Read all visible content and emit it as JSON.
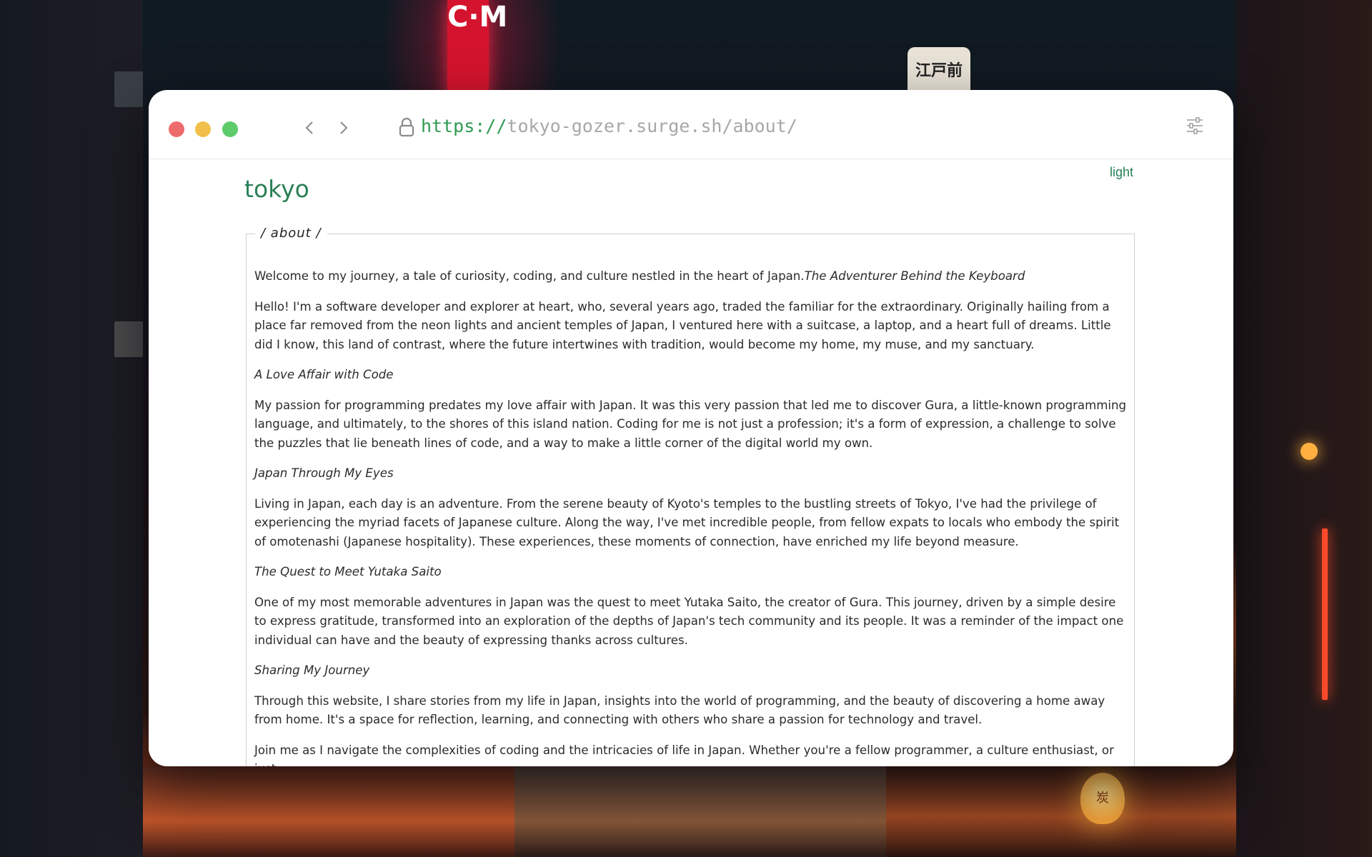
{
  "browser": {
    "url_scheme": "https://",
    "url_rest": "tokyo-gozer.surge.sh/about/"
  },
  "background": {
    "neon_sign_text": "C·M",
    "edo_sign_text": "江戸前",
    "lamp_text": "炭"
  },
  "site": {
    "title": "tokyo",
    "theme_toggle_label": "light",
    "accent_color": "#2a8056"
  },
  "about": {
    "legend": "/ about /",
    "intro": "Welcome to my journey, a tale of curiosity, coding, and culture nestled in the heart of Japan.",
    "intro_heading": "The Adventurer Behind the Keyboard",
    "p1": "Hello! I'm a software developer and explorer at heart, who, several years ago, traded the familiar for the extraordinary. Originally hailing from a place far removed from the neon lights and ancient temples of Japan, I ventured here with a suitcase, a laptop, and a heart full of dreams. Little did I know, this land of contrast, where the future intertwines with tradition, would become my home, my muse, and my sanctuary.",
    "h2": "A Love Affair with Code",
    "p2": "My passion for programming predates my love affair with Japan. It was this very passion that led me to discover Gura, a little-known programming language, and ultimately, to the shores of this island nation. Coding for me is not just a profession; it's a form of expression, a challenge to solve the puzzles that lie beneath lines of code, and a way to make a little corner of the digital world my own.",
    "h3": "Japan Through My Eyes",
    "p3": "Living in Japan, each day is an adventure. From the serene beauty of Kyoto's temples to the bustling streets of Tokyo, I've had the privilege of experiencing the myriad facets of Japanese culture. Along the way, I've met incredible people, from fellow expats to locals who embody the spirit of omotenashi (Japanese hospitality). These experiences, these moments of connection, have enriched my life beyond measure.",
    "h4": "The Quest to Meet Yutaka Saito",
    "p4": "One of my most memorable adventures in Japan was the quest to meet Yutaka Saito, the creator of Gura. This journey, driven by a simple desire to express gratitude, transformed into an exploration of the depths of Japan's tech community and its people. It was a reminder of the impact one individual can have and the beauty of expressing thanks across cultures.",
    "h5": "Sharing My Journey",
    "p5": "Through this website, I share stories from my life in Japan, insights into the world of programming, and the beauty of discovering a home away from home. It's a space for reflection, learning, and connecting with others who share a passion for technology and travel.",
    "p6": "Join me as I navigate the complexities of coding and the intricacies of life in Japan. Whether you're a fellow programmer, a culture enthusiast, or just"
  }
}
